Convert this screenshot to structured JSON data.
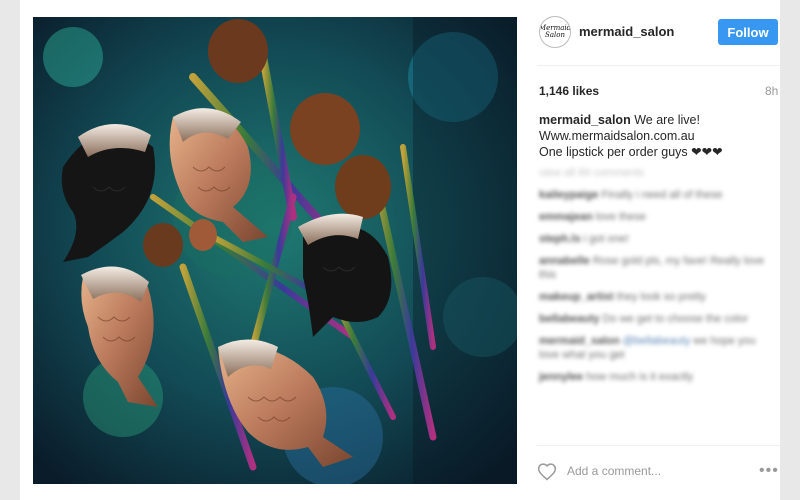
{
  "post": {
    "username": "mermaid_salon",
    "avatar_text": "Mermaid Salon",
    "follow_label": "Follow",
    "likes": "1,146 likes",
    "time": "8h",
    "caption_user": "mermaid_salon",
    "caption_line1": "We are live!",
    "caption_line2": "Www.mermaidsalon.com.au",
    "caption_line3": "One lipstick per order guys ❤❤❤",
    "add_comment_placeholder": "Add a comment...",
    "more_label": "•••",
    "photo_alt": "mermaid tail makeup brushes on sequins"
  },
  "comments": [
    {
      "text": "view all 89 comments",
      "kind": "link"
    },
    {
      "user": "kaileypaige",
      "text": "Finally i need all of these"
    },
    {
      "user": "emmajean",
      "text": "love these"
    },
    {
      "user": "steph.ls",
      "text": "i got one!"
    },
    {
      "user": "annabelle",
      "text": "Rose gold pls, my fave! Really love this"
    },
    {
      "user": "makeup_artist",
      "text": "they look so pretty"
    },
    {
      "user": "bellabeauty",
      "text": "Do we get to choose the color"
    },
    {
      "user": "mermaid_salon",
      "text": "we hope you love what you get",
      "mention": "@bellabeauty"
    },
    {
      "user": "jennylee",
      "text": "how much is it exactly"
    }
  ]
}
